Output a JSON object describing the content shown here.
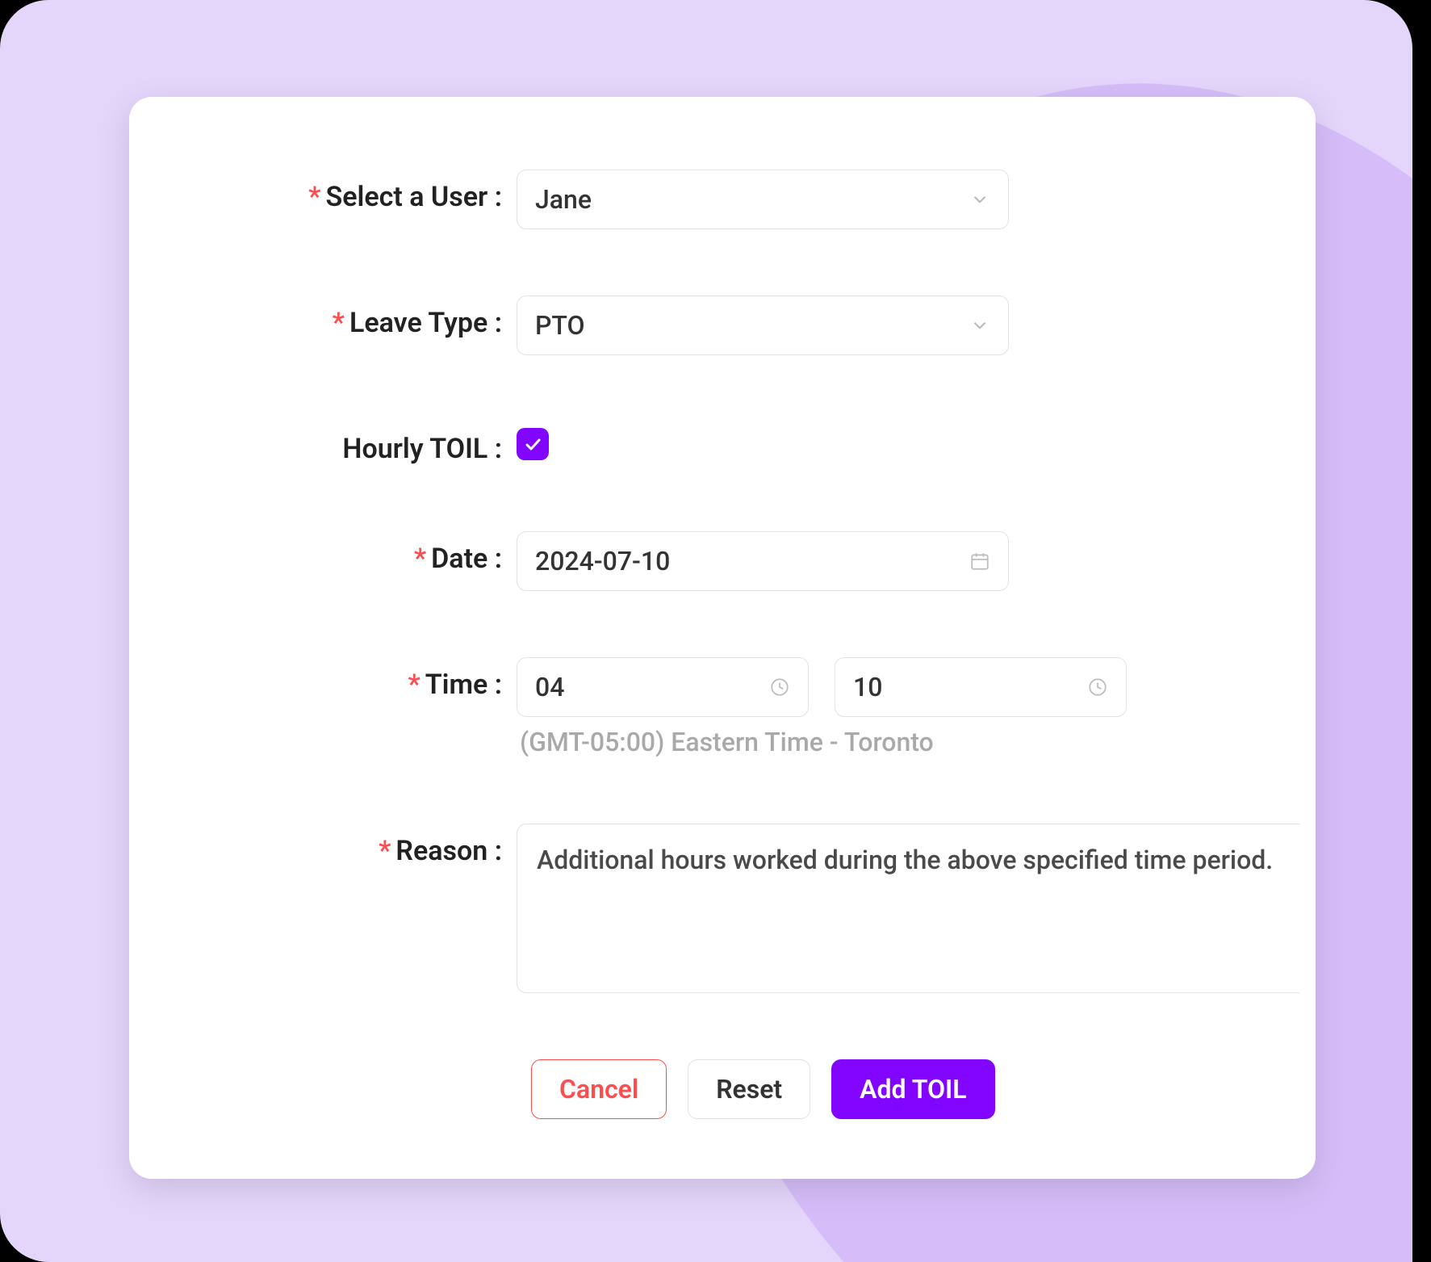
{
  "form": {
    "user": {
      "label": "Select a User",
      "value": "Jane"
    },
    "leaveType": {
      "label": "Leave Type",
      "value": "PTO"
    },
    "hourly": {
      "label": "Hourly TOIL",
      "checked": true
    },
    "date": {
      "label": "Date",
      "value": "2024-07-10"
    },
    "time": {
      "label": "Time",
      "start": "04",
      "end": "10",
      "tz": "(GMT-05:00) Eastern Time - Toronto"
    },
    "reason": {
      "label": "Reason",
      "value": "Additional hours worked during the above specified time period."
    }
  },
  "buttons": {
    "cancel": "Cancel",
    "reset": "Reset",
    "submit": "Add TOIL"
  }
}
